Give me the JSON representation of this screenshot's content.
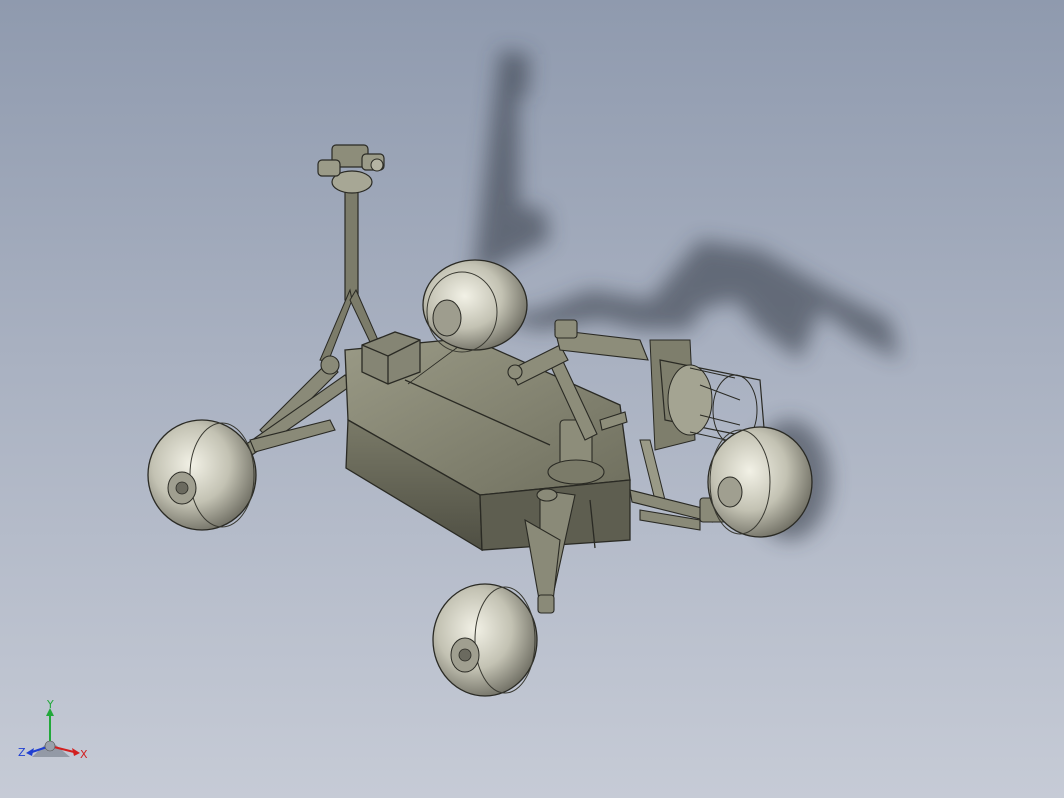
{
  "viewport": {
    "background_top": "#8f9aae",
    "background_bottom": "#c6cbd6",
    "model_fill": "#8a8a78",
    "model_edge": "#2a2a24",
    "wheel_fill": "#bdbcae",
    "shadow_color": "#2f3440"
  },
  "triad": {
    "x_label": "X",
    "y_label": "Y",
    "z_label": "Z",
    "x_color": "#d21f1f",
    "y_color": "#22a83a",
    "z_color": "#1f3fd2"
  }
}
